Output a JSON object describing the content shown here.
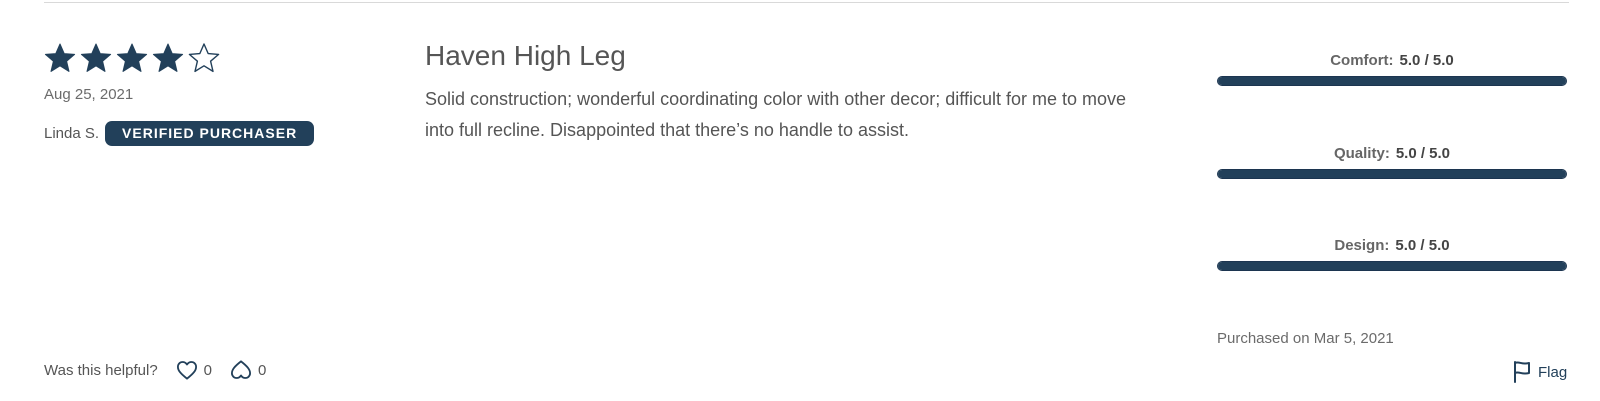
{
  "review": {
    "rating": 4,
    "max_rating": 5,
    "date": "Aug 25, 2021",
    "reviewer_name": "Linda S.",
    "verified_label": "VERIFIED PURCHASER",
    "title": "Haven High Leg",
    "body": "Solid construction; wonderful coordinating color with other decor; difficult for me to move into full recline. Disappointed that there’s no handle to assist."
  },
  "ratings": [
    {
      "label": "Comfort:",
      "value_text": "5.0 / 5.0",
      "value": 5.0,
      "max": 5.0
    },
    {
      "label": "Quality:",
      "value_text": "5.0 / 5.0",
      "value": 5.0,
      "max": 5.0
    },
    {
      "label": "Design:",
      "value_text": "5.0 / 5.0",
      "value": 5.0,
      "max": 5.0
    }
  ],
  "purchased_on": "Purchased on Mar 5, 2021",
  "helpful": {
    "label": "Was this helpful?",
    "upvotes": "0",
    "downvotes": "0"
  },
  "flag_label": "Flag",
  "colors": {
    "accent": "#22405a",
    "text": "#555555",
    "muted": "#6b6b6b"
  },
  "icons": {
    "star_filled": "star-filled-icon",
    "star_empty": "star-empty-icon",
    "upvote": "heart-icon",
    "downvote": "heart-outline-icon",
    "flag": "flag-icon"
  }
}
